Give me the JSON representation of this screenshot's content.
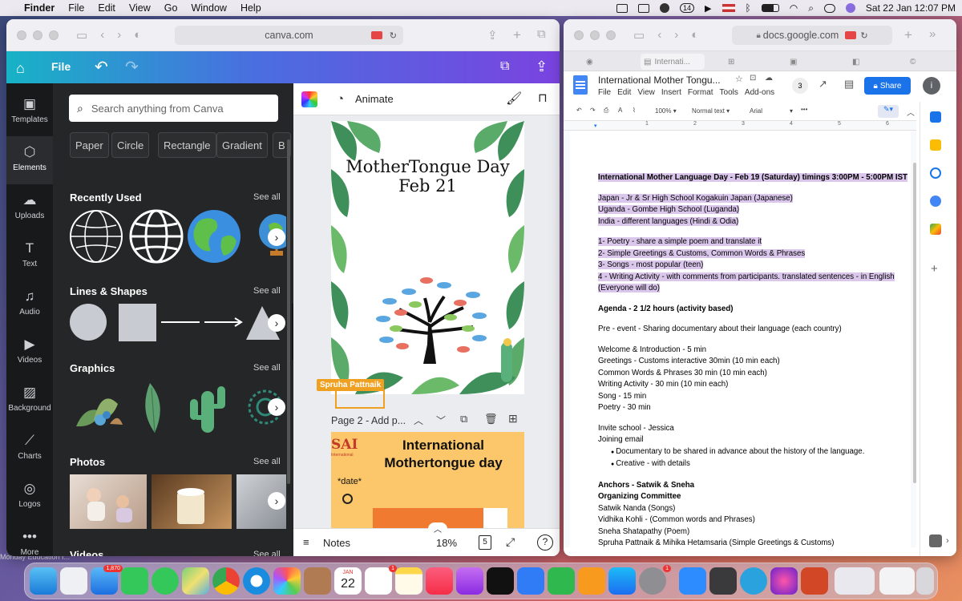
{
  "menubar": {
    "app": "Finder",
    "items": [
      "File",
      "Edit",
      "View",
      "Go",
      "Window",
      "Help"
    ],
    "date_time": "Sat 22 Jan  12:07 PM",
    "cal_badge": "14"
  },
  "canva": {
    "url": "canva.com",
    "file_label": "File",
    "rail": [
      "Templates",
      "Elements",
      "Uploads",
      "Text",
      "Audio",
      "Videos",
      "Background",
      "Charts",
      "Logos",
      "More"
    ],
    "search_placeholder": "Search anything from Canva",
    "chips": [
      "Paper",
      "Circle",
      "Rectangle",
      "Gradient",
      "B"
    ],
    "sections": {
      "recent": "Recently Used",
      "lines": "Lines & Shapes",
      "graphics": "Graphics",
      "photos": "Photos",
      "videos": "Videos"
    },
    "see_all": "See all",
    "animate": "Animate",
    "page1_title_1": "MotherTongue Day",
    "page1_title_2": "Feb 21",
    "collaborator": "Spruha Pattnaik",
    "page2_label": "Page 2 - Add p...",
    "page2_title_1": "International",
    "page2_title_2": "Mothertongue day",
    "page2_logo": "SAI",
    "page2_logo_sub": "International",
    "page2_date": "*date*",
    "notes": "Notes",
    "zoom": "18%",
    "page_count": "5",
    "help": "?"
  },
  "docs": {
    "url": "docs.google.com",
    "tab2": "Internati...",
    "title": "International Mother Tongu...",
    "menu": [
      "File",
      "Edit",
      "View",
      "Insert",
      "Format",
      "Tools",
      "Add-ons"
    ],
    "collab_count": "3",
    "share": "Share",
    "zoom": "100%",
    "style": "Normal text",
    "font": "Arial",
    "ruler": [
      "1",
      "2",
      "3",
      "4",
      "5",
      "6"
    ],
    "lines": [
      {
        "t": "International Mother Language Day  -  Feb 19 (Saturday)  timings  3:00PM  - 5:00PM IST",
        "b": true,
        "hl": true
      },
      {
        "t": "",
        "gap": true
      },
      {
        "t": "Japan - Jr & Sr High School Kogakuin Japan (Japanese)",
        "hl": true
      },
      {
        "t": "Uganda - Gombe High School (Luganda)",
        "hl": true
      },
      {
        "t": "India - different languages (Hindi & Odia)",
        "hl": true
      },
      {
        "t": "",
        "gap": true
      },
      {
        "t": "1- Poetry - share a simple poem and translate it",
        "hl": true
      },
      {
        "t": "2- Simple Greetings &  Customs, Common Words & Phrases",
        "hl": true
      },
      {
        "t": "3- Songs - most popular (teen)",
        "hl": true
      },
      {
        "t": "4 - Writing Activity -  with comments from participants. translated sentences  - in English",
        "hl": true
      },
      {
        "t": "(Everyone will do)",
        "hl": true
      },
      {
        "t": "",
        "gap": true
      },
      {
        "t": "Agenda - 2 1/2 hours (activity based)",
        "b": true
      },
      {
        "t": "",
        "gap": true
      },
      {
        "t": "Pre - event - Sharing documentary about their language (each country)"
      },
      {
        "t": "",
        "gap": true
      },
      {
        "t": "Welcome & Introduction - 5 min"
      },
      {
        "t": "Greetings - Customs interactive 30min (10 min each)"
      },
      {
        "t": "Common Words & Phrases 30 min (10 min each)"
      },
      {
        "t": "Writing Activity - 30 min (10 min each)"
      },
      {
        "t": "Song - 15 min"
      },
      {
        "t": "Poetry - 30 min"
      },
      {
        "t": "",
        "gap": true
      },
      {
        "t": "Invite school - Jessica"
      },
      {
        "t": "Joining email"
      },
      {
        "t": "Documentary to be shared in advance about the history of the language.",
        "bullet": true
      },
      {
        "t": "Creative - with details",
        "bullet": true
      },
      {
        "t": "",
        "gap": true
      },
      {
        "t": "Anchors - Satwik & Sneha",
        "b": true
      },
      {
        "t": "Organizing Committee",
        "b": true
      },
      {
        "t": "Satwik Nanda (Songs)"
      },
      {
        "t": "Vidhika Kohli - (Common words and Phrases)"
      },
      {
        "t": "Sneha Shatapathy (Poem)"
      },
      {
        "t": "Spruha Pattnaik & Mihika Hetamsaria (Simple Greetings &  Customs)"
      }
    ]
  },
  "dock": {
    "mail_badge": "1,870",
    "cal_month": "JAN",
    "cal_day": "22",
    "reminders_badge": "1",
    "settings_badge": "1"
  },
  "bg_snippets": [
    "Monday  Education I..."
  ]
}
